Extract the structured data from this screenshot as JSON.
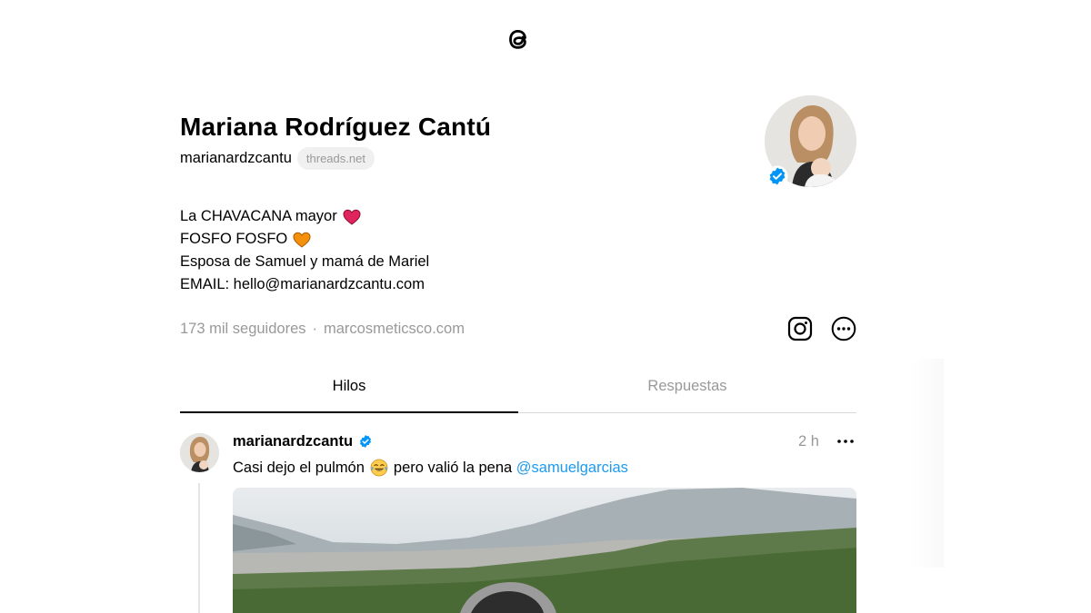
{
  "app": {
    "logo_icon": "threads-logo-icon"
  },
  "profile": {
    "name": "Mariana Rodríguez Cantú",
    "username": "marianardzcantu",
    "host_badge": "threads.net",
    "verified": true,
    "bio": [
      {
        "text": "La CHAVACANA mayor",
        "emoji": "red-heart-icon"
      },
      {
        "text": "FOSFO FOSFO",
        "emoji": "orange-heart-icon"
      },
      {
        "text": "Esposa de Samuel y mamá de Mariel",
        "emoji": null
      },
      {
        "text": "EMAIL: hello@marianardzcantu.com",
        "emoji": null
      }
    ],
    "followers": "173 mil seguidores",
    "separator": "·",
    "website": "marcosmeticsco.com"
  },
  "tabs": [
    {
      "label": "Hilos",
      "active": true
    },
    {
      "label": "Respuestas",
      "active": false
    }
  ],
  "post": {
    "username": "marianardzcantu",
    "verified": true,
    "time": "2 h",
    "text_before": "Casi dejo el pulmón",
    "text_emoji": "face-with-tears-of-joy-icon",
    "text_after": "pero valió la pena",
    "mention": "@samuelgarcias"
  },
  "colors": {
    "verified_blue": "#0095f6",
    "mention_blue": "#1d9bf0",
    "muted_gray": "#999999",
    "heart_red": "#e0245e",
    "heart_orange": "#f4900c"
  }
}
